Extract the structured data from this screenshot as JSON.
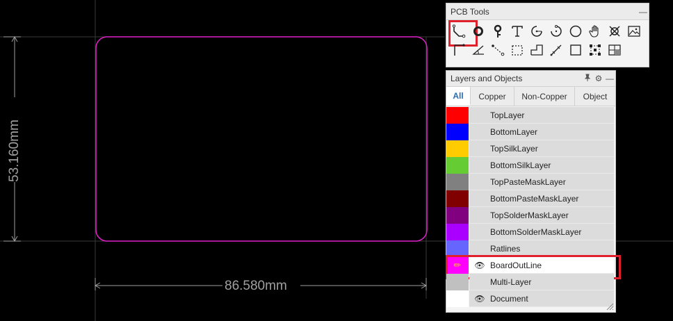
{
  "canvas": {
    "board_color": "#e020c8",
    "dimension_color": "#a0a0a0",
    "grid_color": "#3a3a3a",
    "width_label": "86.580mm",
    "height_label": "53.160mm"
  },
  "pcb_tools": {
    "title": "PCB Tools",
    "minimize_glyph": "—",
    "row1": [
      {
        "name": "route-track-icon",
        "selected": true
      },
      {
        "name": "via-icon"
      },
      {
        "name": "pad-icon"
      },
      {
        "name": "text-icon"
      },
      {
        "name": "arc-center-icon"
      },
      {
        "name": "arc-endpoints-icon"
      },
      {
        "name": "circle-icon"
      },
      {
        "name": "pan-hand-icon"
      },
      {
        "name": "cross-select-icon"
      },
      {
        "name": "image-icon"
      }
    ],
    "row2": [
      {
        "name": "line-icon"
      },
      {
        "name": "angle-icon"
      },
      {
        "name": "connect-icon"
      },
      {
        "name": "region-select-icon"
      },
      {
        "name": "copper-area-icon"
      },
      {
        "name": "measure-icon"
      },
      {
        "name": "rectangle-icon"
      },
      {
        "name": "group-icon"
      },
      {
        "name": "table-icon"
      }
    ]
  },
  "layers_panel": {
    "title": "Layers and Objects",
    "pin_glyph": "📌",
    "gear_glyph": "⚙",
    "minimize_glyph": "—",
    "tabs": [
      "All",
      "Copper",
      "Non-Copper",
      "Object"
    ],
    "active_tab": "All",
    "eye_glyph": "👁",
    "pencil_glyph": "✏",
    "layers": [
      {
        "name": "TopLayer",
        "color": "#ff0000",
        "eye": false
      },
      {
        "name": "BottomLayer",
        "color": "#0000ff",
        "eye": false
      },
      {
        "name": "TopSilkLayer",
        "color": "#ffcc00",
        "eye": false
      },
      {
        "name": "BottomSilkLayer",
        "color": "#66cc33",
        "eye": false
      },
      {
        "name": "TopPasteMaskLayer",
        "color": "#808080",
        "eye": false
      },
      {
        "name": "BottomPasteMaskLayer",
        "color": "#800000",
        "eye": false
      },
      {
        "name": "TopSolderMaskLayer",
        "color": "#800080",
        "eye": false
      },
      {
        "name": "BottomSolderMaskLayer",
        "color": "#aa00ff",
        "eye": false
      },
      {
        "name": "Ratlines",
        "color": "#6666ff",
        "eye": false
      },
      {
        "name": "BoardOutLine",
        "color": "#ff00ff",
        "eye": true,
        "active": true
      },
      {
        "name": "Multi-Layer",
        "color": "#c0c0c0",
        "eye": false
      },
      {
        "name": "Document",
        "color": "#ffffff",
        "eye": true
      }
    ]
  }
}
